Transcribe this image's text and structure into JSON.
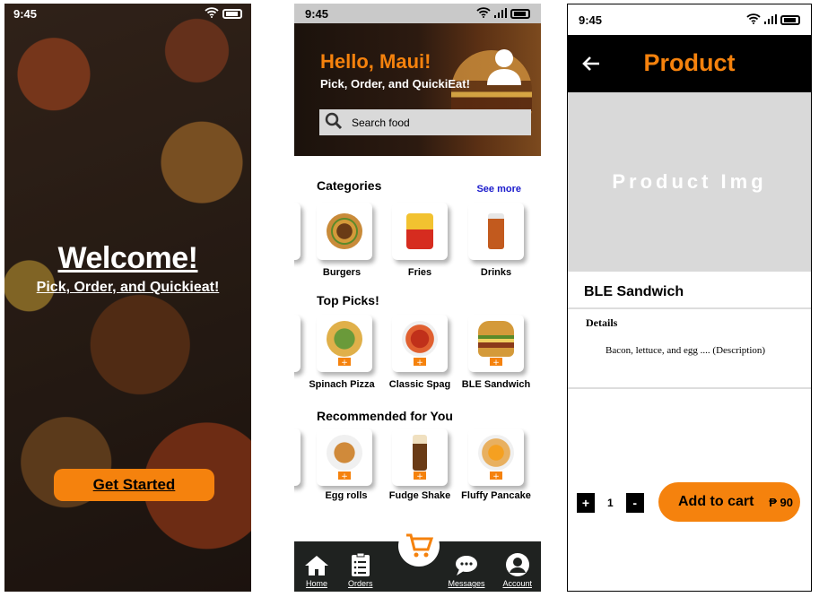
{
  "colors": {
    "accent": "#f5820d",
    "dark": "#1f2220",
    "link": "#1a1acc",
    "placeholder_gray": "#d9d9d9"
  },
  "welcome_screen": {
    "status_time": "9:45",
    "title": "Welcome!",
    "subtitle": "Pick, Order, and Quickieat!",
    "cta_label": "Get Started"
  },
  "home_screen": {
    "status_time": "9:45",
    "greeting": "Hello, Maui!",
    "tagline": "Pick, Order, and QuickiEat!",
    "search_placeholder": "Search food",
    "categories_title": "Categories",
    "see_more": "See more",
    "categories": [
      {
        "label": "Burgers",
        "icon": "burger-icon"
      },
      {
        "label": "Fries",
        "icon": "fries-icon"
      },
      {
        "label": "Drinks",
        "icon": "drink-icon"
      }
    ],
    "top_picks_title": "Top Picks!",
    "top_picks": [
      {
        "label": "Spinach Pizza",
        "icon": "pizza-icon"
      },
      {
        "label": "Classic Spag",
        "icon": "spaghetti-icon"
      },
      {
        "label": "BLE Sandwich",
        "icon": "sandwich-icon"
      }
    ],
    "recommended_title": "Recommended for You",
    "recommended": [
      {
        "label": "Egg rolls",
        "icon": "egg-rolls-icon"
      },
      {
        "label": "Fudge Shake",
        "icon": "shake-icon"
      },
      {
        "label": "Fluffy Pancake",
        "icon": "pancake-icon"
      }
    ],
    "nav": [
      {
        "label": "Home",
        "icon": "home-icon"
      },
      {
        "label": "Orders",
        "icon": "orders-icon"
      },
      {
        "label": "Messages",
        "icon": "messages-icon"
      },
      {
        "label": "Account",
        "icon": "account-icon"
      }
    ]
  },
  "product_screen": {
    "status_time": "9:45",
    "title": "Product",
    "image_placeholder": "Product Img",
    "product_name": "BLE Sandwich",
    "details_heading": "Details",
    "description": "Bacon, lettuce, and egg .... (Description)",
    "quantity": "1",
    "minus_label": "-",
    "plus_label": "+",
    "add_to_cart": "Add to cart",
    "price": "₱ 90"
  }
}
